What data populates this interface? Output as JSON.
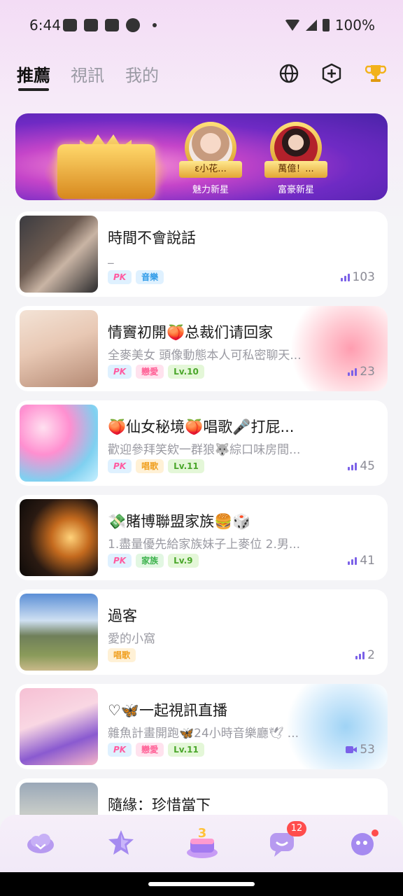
{
  "status_bar": {
    "time": "6:44",
    "battery": "100%",
    "icons": [
      "discord-icon",
      "discord-icon",
      "sticker-icon",
      "line-icon",
      "dot-icon",
      "wifi-icon",
      "cell-signal-icon",
      "battery-icon"
    ]
  },
  "header": {
    "tabs": [
      {
        "label": "推薦",
        "active": true
      },
      {
        "label": "視訊",
        "active": false
      },
      {
        "label": "我的",
        "active": false
      }
    ],
    "icons": [
      "globe-icon",
      "add-circle-icon",
      "trophy-icon"
    ]
  },
  "banner": {
    "medals": [
      {
        "name": "ε小花...",
        "caption": "魅力新星"
      },
      {
        "name": "萬億！...",
        "caption": "富豪新星"
      }
    ]
  },
  "rooms": [
    {
      "title": "時間不會說話",
      "subtitle": "_",
      "tags": [
        "PK",
        "音樂"
      ],
      "count": "103",
      "count_icon": "signal-bars-icon"
    },
    {
      "title": "情竇初開🍑总裁们请回家",
      "subtitle": "全麥美女 頭像動態本人可私密聊天...",
      "tags": [
        "PK",
        "戀愛",
        "Lv.10"
      ],
      "count": "23",
      "count_icon": "signal-bars-icon"
    },
    {
      "title": "🍑仙女秘境🍑唱歌🎤打屁...",
      "subtitle": "歡迎參拜笑欸一群狼🐺綜口味房間...",
      "tags": [
        "PK",
        "唱歌",
        "Lv.11"
      ],
      "count": "45",
      "count_icon": "signal-bars-icon"
    },
    {
      "title": "💸賭博聯盟家族🍔🎲",
      "subtitle": "1.盡量優先給家族妹子上麥位 2.男...",
      "tags": [
        "PK",
        "家族",
        "Lv.9"
      ],
      "count": "41",
      "count_icon": "signal-bars-icon"
    },
    {
      "title": "過客",
      "subtitle": "愛的小窩",
      "tags": [
        "唱歌"
      ],
      "count": "2",
      "count_icon": "signal-bars-icon"
    },
    {
      "title": "♡🦋一起視訊直播",
      "subtitle": "雜魚計畫開跑🦋24小時音樂廳🕊 ...",
      "tags": [
        "PK",
        "戀愛",
        "Lv.11"
      ],
      "count": "53",
      "count_icon": "video-camera-icon"
    },
    {
      "title": "隨緣：珍惜當下",
      "subtitle": "",
      "tags": [],
      "count": "",
      "count_icon": ""
    }
  ],
  "bottom_nav": {
    "items": [
      "home-cloud-icon",
      "star-icon",
      "party-cake-icon",
      "chat-icon",
      "profile-icon"
    ],
    "chat_badge": "12"
  },
  "colors": {
    "accent_purple": "#7b61e8",
    "badge_red": "#ff4d4d",
    "pk_pink": "#ff5aa0"
  }
}
